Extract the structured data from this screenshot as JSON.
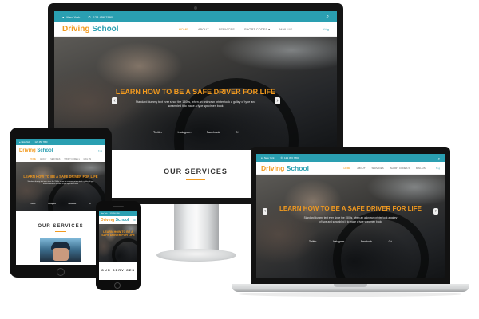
{
  "site": {
    "logo_word1": "Driving",
    "logo_word2": "School",
    "location": "New York",
    "phone": "123 456 7890",
    "menu": [
      "HOME",
      "ABOUT",
      "SERVICES",
      "SHORT CODES ▾",
      "MAIL US"
    ],
    "active_menu": "HOME",
    "social_icons": [
      "facebook-icon",
      "twitter-icon",
      "google-plus-icon"
    ],
    "social_glyphs": "f  t  g"
  },
  "hero": {
    "headline": "LEARN HOW TO BE A SAFE DRIVER FOR LIFE",
    "mobile_headline": "LEARN HOW TO BE A SAFE DRIVER FOR LIFE",
    "subtitle": "Standard dummy text ever since the 1500s, when an unknown printer took a galley of type and scrambled it to make a type specimen book",
    "social_links": [
      "Twitter",
      "Instagram",
      "Facebook",
      "G+"
    ],
    "prev_arrow": "‹",
    "next_arrow": "›"
  },
  "services": {
    "title": "OUR SERVICES"
  },
  "colors": {
    "teal": "#2a9fb1",
    "orange": "#f29a1f",
    "device_dark": "#151515"
  }
}
